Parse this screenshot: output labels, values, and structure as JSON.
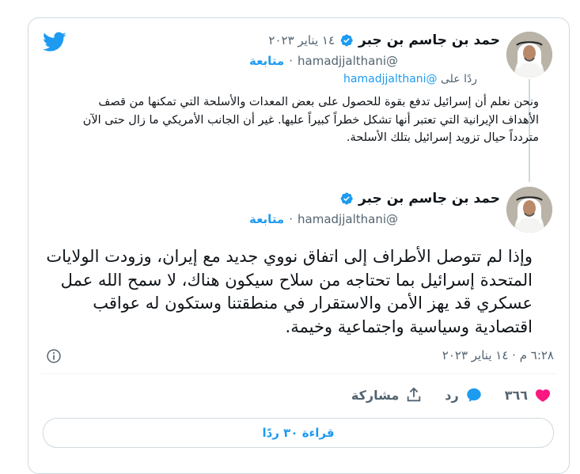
{
  "colors": {
    "accent": "#1d9bf0",
    "like": "#f91880",
    "muted": "#536471",
    "text": "#0f1419",
    "border": "#cfd9de"
  },
  "quoted_tweet": {
    "author_name": "حمد بن جاسم بن جبر",
    "date": "١٤ يناير ٢٠٢٣",
    "handle": "@hamadjjalthani",
    "follow_label": "متابعة",
    "reply_prefix": "ردًا على",
    "reply_handle": "@hamadjjalthani",
    "text": "ونحن نعلم أن إسرائيل تدفع بقوة للحصول على بعض المعدات والأسلحة التي تمكنها من قصف الأهداف الإيرانية التي تعتبر أنها تشكل خطراً كبيراً عليها. غير أن الجانب الأمريكي ما زال حتى الآن متردداً حيال تزويد إسرائيل بتلك الأسلحة."
  },
  "main_tweet": {
    "author_name": "حمد بن جاسم بن جبر",
    "handle": "@hamadjjalthani",
    "follow_label": "متابعة",
    "text": "وإذا لم تتوصل الأطراف إلى اتفاق نووي جديد مع إيران، وزودت الولايات المتحدة إسرائيل بما تحتاجه من سلاح سيكون هناك، لا سمح الله عمل عسكري قد يهز الأمن والاستقرار في منطقتنا وستكون له عواقب اقتصادية وسياسية واجتماعية وخيمة.",
    "timestamp": "٦:٢٨ م · ١٤ يناير ٢٠٢٣"
  },
  "actions": {
    "likes_count": "٣٦٦",
    "reply_label": "رد",
    "share_label": "مشاركة"
  },
  "read_replies_label": "قراءة ٣٠ ردًا",
  "icons": [
    "twitter-logo-icon",
    "verified-badge-icon",
    "info-icon",
    "heart-icon",
    "reply-bubble-icon",
    "share-icon"
  ]
}
